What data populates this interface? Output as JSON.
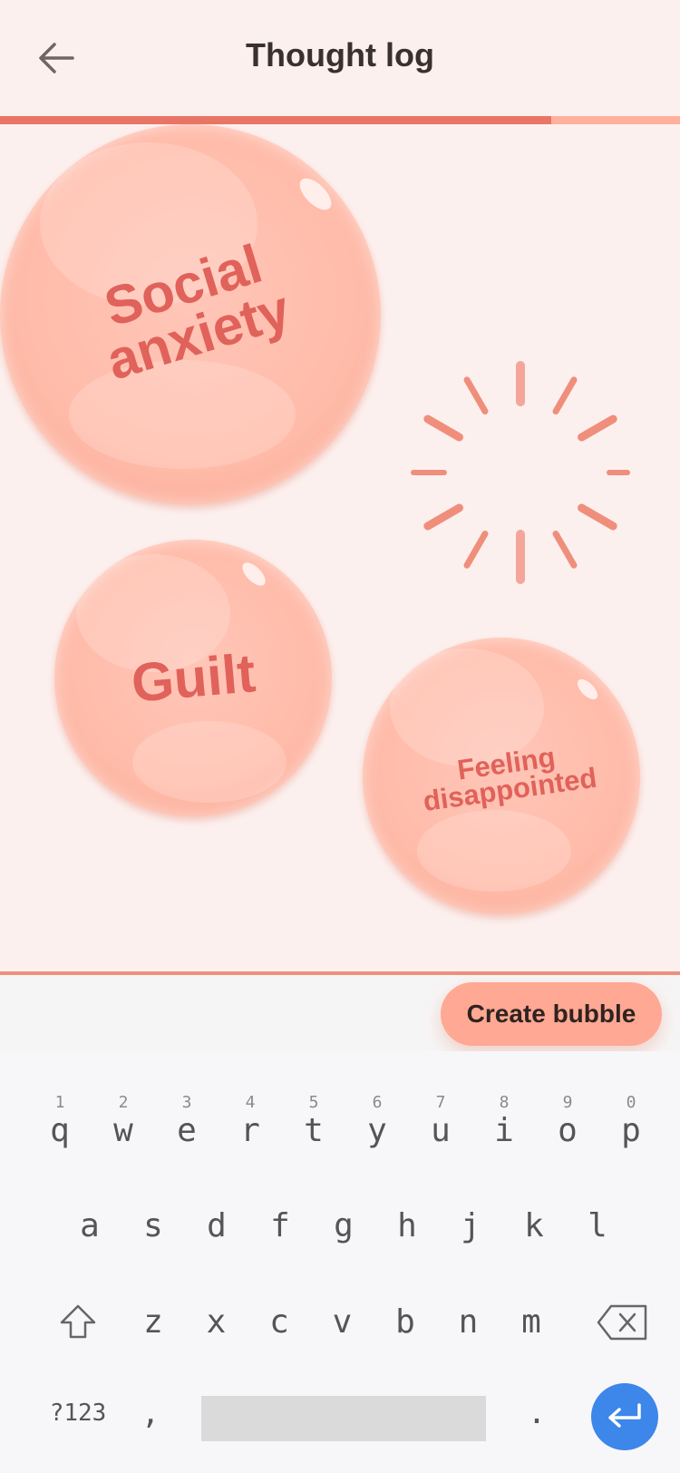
{
  "header": {
    "title": "Thought log",
    "back_icon": "arrow-left-icon"
  },
  "progress": {
    "fraction": 0.81,
    "fill_color": "#e87565",
    "track_color": "#ffb19d"
  },
  "bubbles": [
    {
      "label_line1": "Social",
      "label_line2": "anxiety"
    },
    {
      "label": "Guilt"
    },
    {
      "label_line1": "Feeling",
      "label_line2": "disappointed"
    }
  ],
  "loading": {
    "icon": "loading-spinner-icon"
  },
  "actions": {
    "create_bubble": "Create bubble",
    "button_color": "#ffa893"
  },
  "keyboard": {
    "row1": [
      {
        "hint": "1",
        "char": "q"
      },
      {
        "hint": "2",
        "char": "w"
      },
      {
        "hint": "3",
        "char": "e"
      },
      {
        "hint": "4",
        "char": "r"
      },
      {
        "hint": "5",
        "char": "t"
      },
      {
        "hint": "6",
        "char": "y"
      },
      {
        "hint": "7",
        "char": "u"
      },
      {
        "hint": "8",
        "char": "i"
      },
      {
        "hint": "9",
        "char": "o"
      },
      {
        "hint": "0",
        "char": "p"
      }
    ],
    "row2": [
      "a",
      "s",
      "d",
      "f",
      "g",
      "h",
      "j",
      "k",
      "l"
    ],
    "row3": [
      "z",
      "x",
      "c",
      "v",
      "b",
      "n",
      "m"
    ],
    "symbols_label": "?123",
    "comma": ",",
    "period": ".",
    "enter_color": "#3d86ea"
  }
}
